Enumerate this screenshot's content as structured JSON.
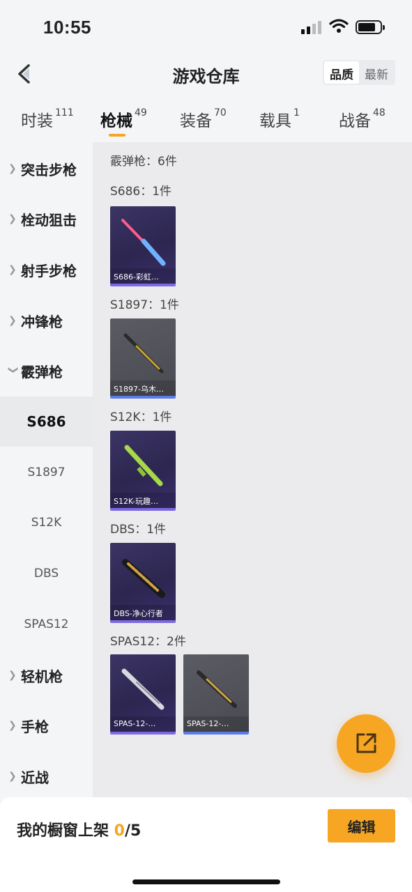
{
  "status": {
    "time": "10:55"
  },
  "nav": {
    "title": "游戏仓库",
    "sort_options": [
      "品质",
      "最新"
    ]
  },
  "tabs": [
    {
      "label": "时装",
      "count": "111"
    },
    {
      "label": "枪械",
      "count": "49"
    },
    {
      "label": "装备",
      "count": "70"
    },
    {
      "label": "载具",
      "count": "1"
    },
    {
      "label": "战备",
      "count": "48"
    }
  ],
  "sidebar": {
    "categories": [
      "突击步枪",
      "栓动狙击",
      "射手步枪",
      "冲锋枪",
      "霰弹枪",
      "轻机枪",
      "手枪",
      "近战"
    ],
    "subcategories": [
      "S686",
      "S1897",
      "S12K",
      "DBS",
      "SPAS12"
    ]
  },
  "content": {
    "section_title": "霰弹枪：6件",
    "groups": [
      {
        "title": "S686：1件",
        "items": [
          {
            "name": "S686-彩虹…",
            "color": "#ff5c8a"
          }
        ]
      },
      {
        "title": "S1897：1件",
        "items": [
          {
            "name": "S1897-乌木…",
            "color": "#c8a22e"
          }
        ]
      },
      {
        "title": "S12K：1件",
        "items": [
          {
            "name": "S12K-玩趣…",
            "color": "#a6d84a"
          }
        ]
      },
      {
        "title": "DBS：1件",
        "items": [
          {
            "name": "DBS-净心行者",
            "color": "#d1a24a"
          }
        ]
      },
      {
        "title": "SPAS12：2件",
        "items": [
          {
            "name": "SPAS-12-…",
            "color": "#d8d8e0"
          },
          {
            "name": "SPAS-12-…",
            "color": "#c9a640"
          }
        ]
      }
    ]
  },
  "bottom": {
    "label": "我的橱窗上架 ",
    "count": "0",
    "total": "/5",
    "edit": "编辑"
  },
  "colors": {
    "accent": "#f6a623",
    "card_purple": "#2c2650",
    "card_gray": "#4a4a52"
  }
}
